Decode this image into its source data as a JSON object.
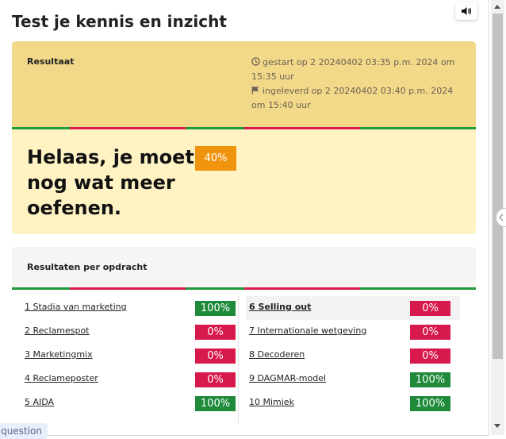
{
  "page": {
    "title": "Test je kennis en inzicht"
  },
  "result": {
    "label": "Resultaat",
    "started": "gestart op 2 20240402 03:35 p.m. 2024 om 15:35 uur",
    "submitted": "ingeleverd op 2 20240402 03:40 p.m. 2024 om 15:40 uur",
    "message": "Helaas, je moet nog wat meer oefenen.",
    "score": "40%",
    "progress_segments": [
      "green",
      "red",
      "red",
      "green",
      "red",
      "red",
      "green",
      "green"
    ]
  },
  "per_assignment": {
    "label": "Resultaten per opdracht",
    "left": [
      {
        "name": "1 Stadia van marketing",
        "score": "100%",
        "status": "ok"
      },
      {
        "name": "2 Reclamespot",
        "score": "0%",
        "status": "bad"
      },
      {
        "name": "3 Marketingmix",
        "score": "0%",
        "status": "bad"
      },
      {
        "name": "4 Reclameposter",
        "score": "0%",
        "status": "bad"
      },
      {
        "name": "5 AIDA",
        "score": "100%",
        "status": "ok"
      }
    ],
    "right": [
      {
        "name": "6 Selling out",
        "score": "0%",
        "status": "bad",
        "highlight": true
      },
      {
        "name": "7 Internationale wetgeving",
        "score": "0%",
        "status": "bad"
      },
      {
        "name": "8 Decoderen",
        "score": "0%",
        "status": "bad"
      },
      {
        "name": "9 DAGMAR-model",
        "score": "100%",
        "status": "ok"
      },
      {
        "name": "10 Mimiek",
        "score": "100%",
        "status": "ok"
      }
    ]
  },
  "footer": {
    "question_tab": "question"
  },
  "colors": {
    "correct": "#1e8a3a",
    "wrong": "#d8194b",
    "score_badge": "#f0930d"
  },
  "icons": {
    "audio": "speaker-icon",
    "started": "clock-icon",
    "submitted": "flag-icon"
  }
}
